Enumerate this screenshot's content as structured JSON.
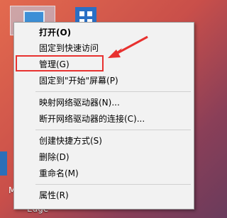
{
  "desktop": {
    "bottom_labels": [
      "M",
      "Edge"
    ]
  },
  "context_menu": {
    "items": [
      {
        "label": "打开(O)"
      },
      {
        "label": "固定到快速访问"
      },
      {
        "label": "管理(G)"
      },
      {
        "label": "固定到\"开始\"屏幕(P)"
      },
      {
        "label": "映射网络驱动器(N)..."
      },
      {
        "label": "断开网络驱动器的连接(C)..."
      },
      {
        "label": "创建快捷方式(S)"
      },
      {
        "label": "删除(D)"
      },
      {
        "label": "重命名(M)"
      },
      {
        "label": "属性(R)"
      }
    ]
  },
  "annotation": {
    "highlight_color": "#e8312f"
  }
}
